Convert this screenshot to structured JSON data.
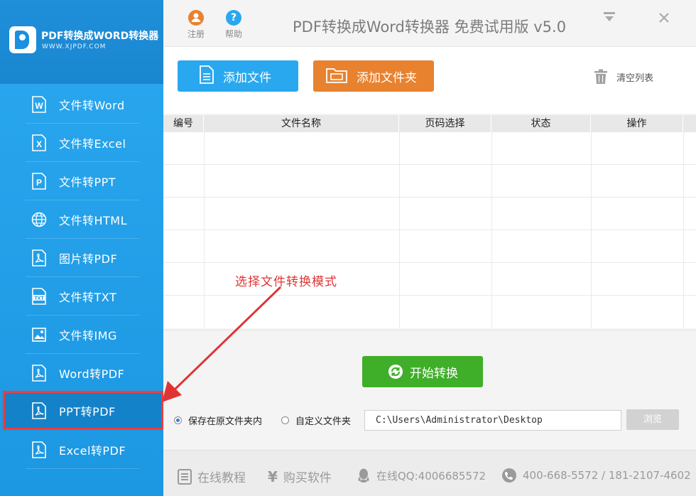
{
  "brand": {
    "title": "PDF转换成WORD转换器",
    "url": "WWW.XJPDF.COM"
  },
  "sidebar": {
    "items": [
      {
        "label": "文件转Word",
        "icon": "word-icon"
      },
      {
        "label": "文件转Excel",
        "icon": "excel-icon"
      },
      {
        "label": "文件转PPT",
        "icon": "ppt-icon"
      },
      {
        "label": "文件转HTML",
        "icon": "globe-icon"
      },
      {
        "label": "图片转PDF",
        "icon": "pdf-icon"
      },
      {
        "label": "文件转TXT",
        "icon": "txt-icon"
      },
      {
        "label": "文件转IMG",
        "icon": "image-icon"
      },
      {
        "label": "Word转PDF",
        "icon": "pdf-icon"
      },
      {
        "label": "PPT转PDF",
        "icon": "pdf-icon",
        "active": true
      },
      {
        "label": "Excel转PDF",
        "icon": "pdf-icon"
      }
    ]
  },
  "titlebar": {
    "register_label": "注册",
    "help_label": "帮助",
    "title": "PDF转换成Word转换器 免费试用版 v5.0",
    "minimize_symbol": "▼",
    "close_symbol": "✕"
  },
  "toolbar": {
    "add_file_label": "添加文件",
    "add_folder_label": "添加文件夹",
    "clear_label": "清空列表"
  },
  "table": {
    "columns": [
      "编号",
      "文件名称",
      "页码选择",
      "状态",
      "操作"
    ],
    "rows": []
  },
  "convert": {
    "start_label": "开始转换",
    "save_original_label": "保存在原文件夹内",
    "custom_folder_label": "自定义文件夹",
    "path_value": "C:\\Users\\Administrator\\Desktop",
    "browse_label": "浏览",
    "selected_option": "save_original"
  },
  "footer": {
    "tutorial_label": "在线教程",
    "buy_label": "购买软件",
    "qq_label": "在线QQ:4006685572",
    "phone_label": "400-668-5572 / 181-2107-4602"
  },
  "annotation": {
    "text": "选择文件转换模式"
  },
  "colors": {
    "sidebar": "#2aa8ef",
    "add_file_button": "#2aa8ef",
    "add_folder_button": "#e8822f",
    "start_button": "#3fae28",
    "highlight": "#ef3b3b"
  }
}
